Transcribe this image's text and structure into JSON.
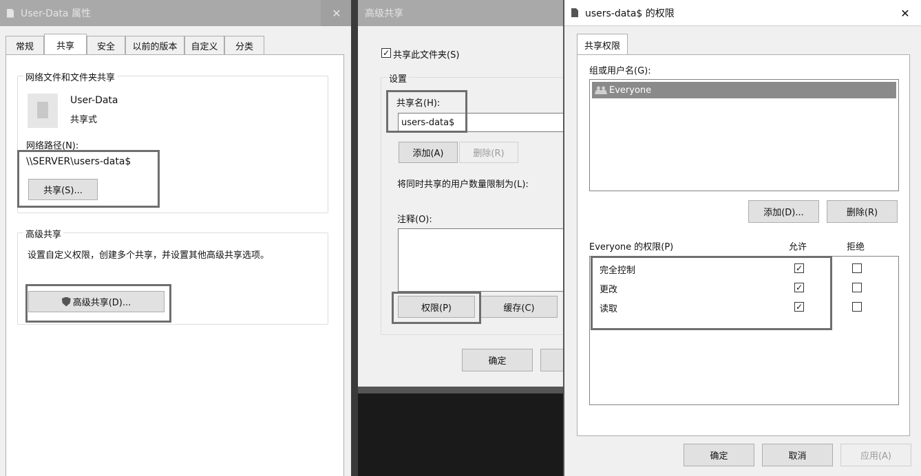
{
  "props_window": {
    "title": "User-Data 属性",
    "tabs": [
      "常规",
      "共享",
      "安全",
      "以前的版本",
      "自定义",
      "分类"
    ],
    "network_group": {
      "title": "网络文件和文件夹共享",
      "folder_name": "User-Data",
      "folder_state": "共享式",
      "path_label": "网络路径(N):",
      "path_value": "\\\\SERVER\\users-data$",
      "share_button": "共享(S)..."
    },
    "advanced_group": {
      "title": "高级共享",
      "description": "设置自定义权限，创建多个共享，并设置其他高级共享选项。",
      "button": "高级共享(D)..."
    }
  },
  "advanced_window": {
    "title": "高级共享",
    "share_checkbox_label": "共享此文件夹(S)",
    "share_checked": true,
    "settings_title": "设置",
    "share_name_label": "共享名(H):",
    "share_name_value": "users-data$",
    "add_button": "添加(A)",
    "remove_button": "删除(R)",
    "limit_label": "将同时共享的用户数量限制为(L):",
    "comment_label": "注释(O):",
    "permissions_button": "权限(P)",
    "cache_button": "缓存(C)",
    "ok_button": "确定"
  },
  "perm_window": {
    "title": "users-data$ 的权限",
    "close": "✕",
    "tab": "共享权限",
    "groups_label": "组或用户名(G):",
    "users": [
      "Everyone"
    ],
    "add_button": "添加(D)...",
    "remove_button": "删除(R)",
    "perm_label": "Everyone 的权限(P)",
    "allow_header": "允许",
    "deny_header": "拒绝",
    "permissions": [
      {
        "name": "完全控制",
        "allow": true,
        "deny": false
      },
      {
        "name": "更改",
        "allow": true,
        "deny": false
      },
      {
        "name": "读取",
        "allow": true,
        "deny": false
      }
    ],
    "ok_button": "确定",
    "cancel_button": "取消",
    "apply_button": "应用(A)"
  },
  "check_mark": "✓"
}
